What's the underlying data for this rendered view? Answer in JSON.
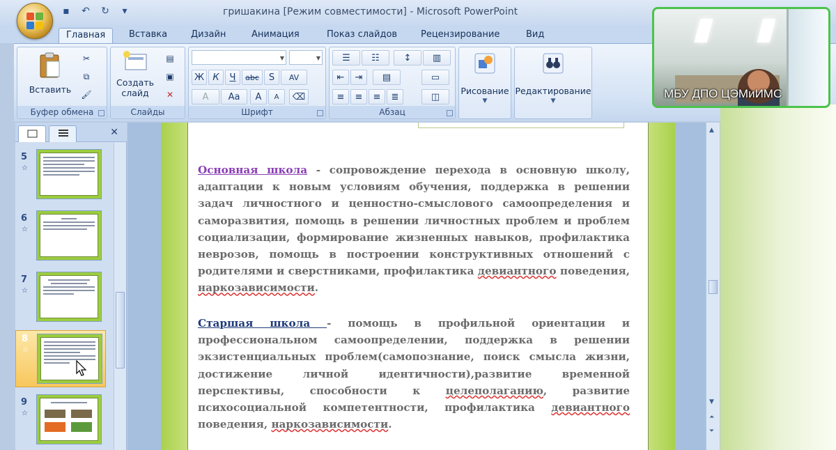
{
  "window": {
    "title": "гришакина [Режим совместимости] - Microsoft PowerPoint"
  },
  "ribbon_tabs": [
    "Главная",
    "Вставка",
    "Дизайн",
    "Анимация",
    "Показ слайдов",
    "Рецензирование",
    "Вид"
  ],
  "active_tab": "Главная",
  "groups": {
    "clipboard": {
      "label": "Буфер обмена",
      "paste": "Вставить"
    },
    "slides": {
      "label": "Слайды",
      "new_slide_1": "Создать",
      "new_slide_2": "слайд"
    },
    "font": {
      "label": "Шрифт"
    },
    "paragraph": {
      "label": "Абзац"
    },
    "drawing": {
      "label": "Рисование"
    },
    "editing": {
      "label": "Редактирование"
    }
  },
  "font_buttons": {
    "bold": "Ж",
    "italic": "К",
    "underline": "Ч",
    "strike": "abc",
    "shadow": "S",
    "spacing": "AV",
    "grow": "A",
    "shrink": "A",
    "case": "Aa",
    "color": "A"
  },
  "thumbnails": [
    {
      "num": "5",
      "star": "☆"
    },
    {
      "num": "6",
      "star": "☆"
    },
    {
      "num": "7",
      "star": "☆"
    },
    {
      "num": "8",
      "star": "☆"
    },
    {
      "num": "9",
      "star": "☆"
    }
  ],
  "slide": {
    "p1_heading": "Основная школа",
    "p1_a": " - сопровождение перехода в основную школу, адаптации к новым условиям обучения, поддержка в решении задач личностного и ценностно-смыслового самоопределения и саморазвития, помощь в решении личностных проблем и проблем социализации, формирование жизненных навыков, профилактика неврозов, помощь в построении конструктивных отношений с родителями и сверстниками, профилактика ",
    "p1_sq1": "девиантного",
    "p1_b": " поведения, ",
    "p1_sq2": "наркозависимости",
    "p1_c": ".",
    "p2_heading": "Старшая школа ",
    "p2_a": " - помощь в профильной ориентации и профессиональном самоопределении, поддержка в решении экзистенциальных проблем(самопознание, поиск смысла жизни, достижение личной идентичности),развитие временной перспективы, способности к ",
    "p2_sq1": "целеполаганию",
    "p2_b": ", развитие психосоциальной компетентности, профилактика ",
    "p2_sq2": "девиантного",
    "p2_c": " поведения, ",
    "p2_sq3": "наркозависимости",
    "p2_d": "."
  },
  "webcam": {
    "label": "МБУ ДПО ЦЭМиИМС"
  }
}
